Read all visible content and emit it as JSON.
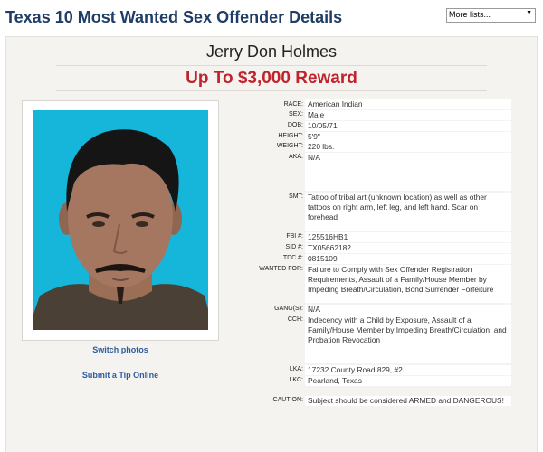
{
  "header": {
    "title": "Texas 10 Most Wanted Sex Offender Details",
    "more_lists": "More lists..."
  },
  "offender": {
    "name": "Jerry Don Holmes",
    "reward": "Up To $3,000 Reward"
  },
  "links": {
    "switch_photos": "Switch photos",
    "submit_tip": "Submit a Tip Online"
  },
  "details": {
    "race": {
      "label": "RACE:",
      "value": "American Indian"
    },
    "sex": {
      "label": "SEX:",
      "value": "Male"
    },
    "dob": {
      "label": "DOB:",
      "value": "10/05/71"
    },
    "height": {
      "label": "HEIGHT:",
      "value": "5'9\""
    },
    "weight": {
      "label": "WEIGHT:",
      "value": "220 lbs."
    },
    "aka": {
      "label": "AKA:",
      "value": "N/A"
    },
    "smt": {
      "label": "SMT:",
      "value": "Tattoo of tribal art (unknown location) as well as other tattoos on right arm, left leg, and left hand. Scar on forehead"
    },
    "fbi": {
      "label": "FBI #:",
      "value": "125516HB1"
    },
    "sid": {
      "label": "SID #:",
      "value": "TX05662182"
    },
    "tdc": {
      "label": "TDC #:",
      "value": "0815109"
    },
    "wanted_for": {
      "label": "WANTED FOR:",
      "value": "Failure to Comply with Sex Offender Registration Requirements, Assault of a Family/House Member by Impeding Breath/Circulation, Bond Surrender Forfeiture"
    },
    "gangs": {
      "label": "GANG(S):",
      "value": "N/A"
    },
    "cch": {
      "label": "CCH:",
      "value": "Indecency with a Child by Exposure, Assault of a Family/House Member by Impeding Breath/Circulation, and Probation Revocation"
    },
    "lka": {
      "label": "LKA:",
      "value": "17232 County Road 829, #2"
    },
    "lkc": {
      "label": "LKC:",
      "value": "Pearland, Texas"
    },
    "caution": {
      "label": "CAUTION:",
      "value": "Subject should be considered ARMED and DANGEROUS!"
    }
  },
  "colors": {
    "title": "#1f3d66",
    "reward": "#c0232b",
    "link": "#2d5c9e",
    "photo_background": "#16b6da",
    "panel": "#f4f3ef"
  }
}
